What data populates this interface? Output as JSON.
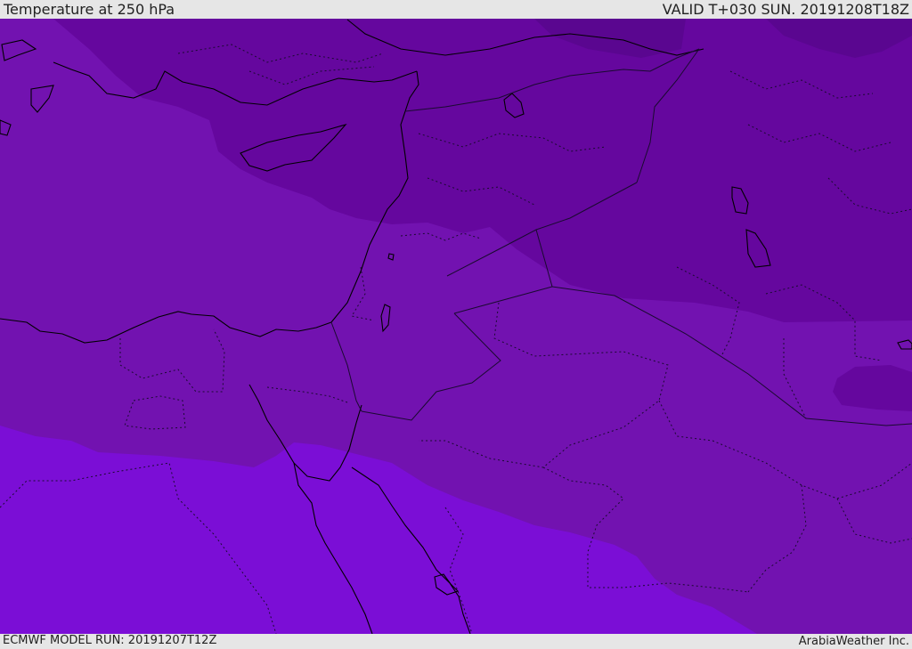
{
  "header": {
    "title": "Temperature at 250 hPa",
    "valid_time": "VALID T+030 SUN. 20191208T18Z"
  },
  "footer": {
    "model_run": "ECMWF MODEL RUN: 20191207T12Z",
    "credit": "ArabiaWeather Inc."
  },
  "temperature_colors": {
    "coldest": "#5a0690",
    "colder": "#65079e",
    "middle": "#7212b0",
    "warmer": "#7b0ed6"
  },
  "line_colors": {
    "coastline": "#000000",
    "border": "#1a0a30"
  }
}
